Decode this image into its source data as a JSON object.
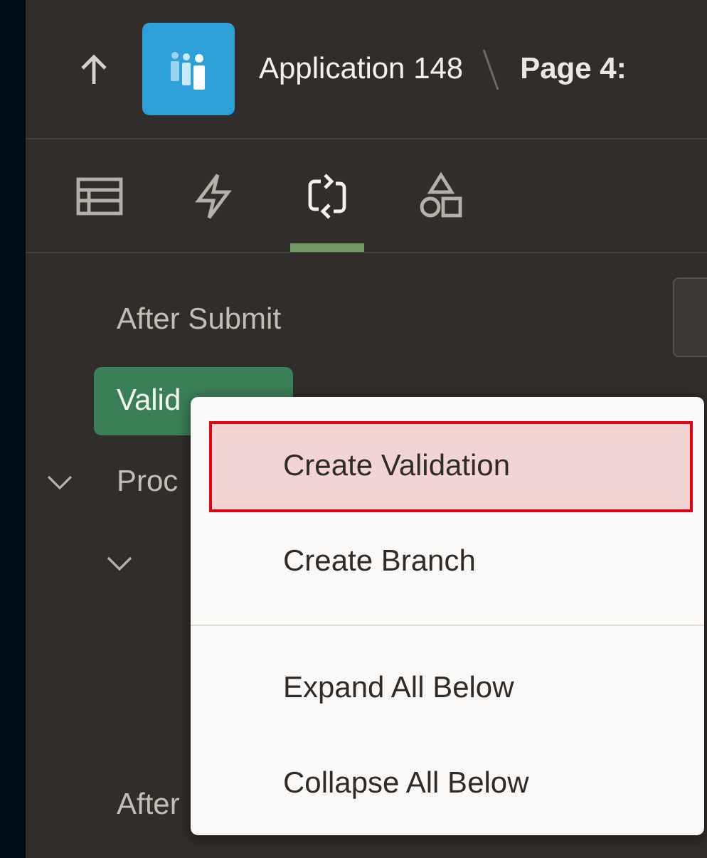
{
  "header": {
    "application": "Application 148",
    "page": "Page 4:"
  },
  "tabs": [
    {
      "kind": "layout",
      "selected": false
    },
    {
      "kind": "lightning",
      "selected": false
    },
    {
      "kind": "loop",
      "selected": true
    },
    {
      "kind": "shapes",
      "selected": false
    }
  ],
  "tree": [
    {
      "label": "After Submit",
      "selected": false
    },
    {
      "label": "Valid",
      "selected": true
    },
    {
      "label": "Proc",
      "expanded": true,
      "children": [
        {
          "expanded": true
        }
      ]
    },
    {
      "label": "After"
    }
  ],
  "context_menu": {
    "items": [
      {
        "label": "Create Validation",
        "selected": true
      },
      {
        "label": "Create Branch",
        "selected": false
      },
      {
        "kind": "separator"
      },
      {
        "label": "Expand All Below",
        "selected": false
      },
      {
        "label": "Collapse All Below",
        "selected": false
      }
    ]
  }
}
